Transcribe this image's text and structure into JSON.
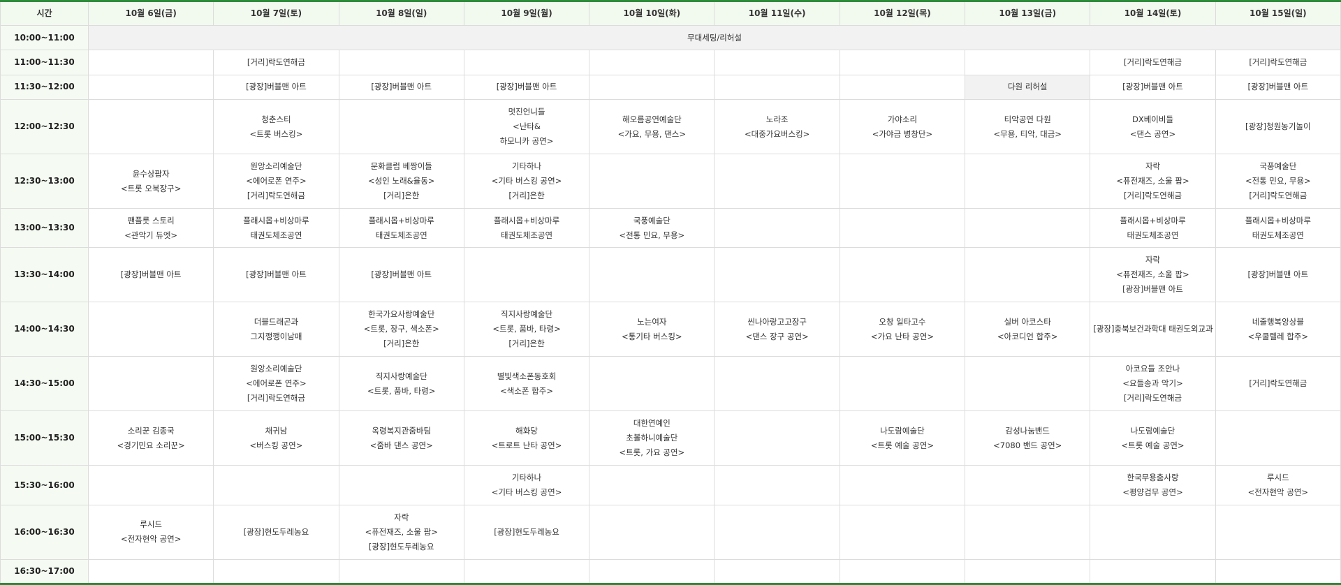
{
  "header": {
    "time_label": "시간",
    "days": [
      "10월 6일(금)",
      "10월 7일(토)",
      "10월 8일(일)",
      "10월 9일(월)",
      "10월 10일(화)",
      "10월 11일(수)",
      "10월 12일(목)",
      "10월 13일(금)",
      "10월 14일(토)",
      "10월 15일(일)"
    ]
  },
  "colors": {
    "accent": "#2e8b3a",
    "header_bg": "#f2f9ef",
    "shaded_cell": "#f2f2f2",
    "grid": "#dcdcdc"
  },
  "rows": [
    {
      "time": "10:00~11:00",
      "full": [
        "무대세팅/리허설"
      ]
    },
    {
      "time": "11:00~11:30",
      "cells": [
        [],
        [
          "[거리]락도연해금"
        ],
        [],
        [],
        [],
        [],
        [],
        [],
        [
          "[거리]락도연해금"
        ],
        [
          "[거리]락도연해금"
        ]
      ]
    },
    {
      "time": "11:30~12:00",
      "cells": [
        [],
        [
          "[광장]버블맨 아트"
        ],
        [
          "[광장]버블맨 아트"
        ],
        [
          "[광장]버블맨 아트"
        ],
        [],
        [],
        [],
        [
          "다원 리허설"
        ],
        [
          "[광장]버블맨 아트"
        ],
        [
          "[광장]버블맨 아트"
        ]
      ],
      "shaded": [
        7
      ]
    },
    {
      "time": "12:00~12:30",
      "cells": [
        [],
        [
          "청춘스티",
          "<트롯 버스킹>"
        ],
        [],
        [
          "멋진언니들",
          "<난타&",
          "하모니카 공연>"
        ],
        [
          "해오름공연예술단",
          "<가요, 무용, 댄스>"
        ],
        [
          "노라조",
          "<대중가요버스킹>"
        ],
        [
          "가야소리",
          "<가야금 병창단>"
        ],
        [
          "티악공연 다원",
          "<무용, 티악, 대금>"
        ],
        [
          "DX베이비들",
          "<댄스 공연>"
        ],
        [
          "[광장]청원농기놀이"
        ]
      ]
    },
    {
      "time": "12:30~13:00",
      "cells": [
        [
          "윤수상팝자",
          "<트롯 오북장구>"
        ],
        [
          "원앙소리예술단",
          "<에어로폰 연주>",
          "[거리]락도연해금"
        ],
        [
          "문화클럽 베짱이들",
          "<성인 노래&율동>",
          "[거리]은한"
        ],
        [
          "기타하나",
          "<기타 버스킹 공연>",
          "[거리]은한"
        ],
        [],
        [],
        [],
        [],
        [
          "자락",
          "<퓨전재즈, 소울 팝>",
          "[거리]락도연해금"
        ],
        [
          "국풍예술단",
          "<전통 민요, 무용>",
          "[거리]락도연해금"
        ]
      ]
    },
    {
      "time": "13:00~13:30",
      "cells": [
        [
          "팬플룻 스토리",
          "<관악기 듀엣>"
        ],
        [
          "플래시몹+비상마루",
          "태권도체조공연"
        ],
        [
          "플래시몹+비상마루",
          "태권도체조공연"
        ],
        [
          "플래시몹+비상마루",
          "태권도체조공연"
        ],
        [
          "국풍예술단",
          "<전통 민요, 무용>"
        ],
        [],
        [],
        [],
        [
          "플래시몹+비상마루",
          "태권도체조공연"
        ],
        [
          "플래시몹+비상마루",
          "태권도체조공연"
        ]
      ]
    },
    {
      "time": "13:30~14:00",
      "cells": [
        [
          "[광장]버블맨 아트"
        ],
        [
          "[광장]버블맨 아트"
        ],
        [
          "[광장]버블맨 아트"
        ],
        [],
        [],
        [],
        [],
        [],
        [
          "자락",
          "<퓨전재즈, 소울 팝>",
          "[광장]버블맨 아트"
        ],
        [
          "[광장]버블맨 아트"
        ]
      ]
    },
    {
      "time": "14:00~14:30",
      "cells": [
        [],
        [
          "더블드래곤과",
          "그지깽깽이남매"
        ],
        [
          "한국가요사랑예술단",
          "<트롯, 장구, 색소폰>",
          "[거리]은한"
        ],
        [
          "직지사랑예술단",
          "<트롯, 품바, 타령>",
          "[거리]은한"
        ],
        [
          "노는여자",
          "<통기타 버스킹>"
        ],
        [
          "씬나아랑고고장구",
          "<댄스 장구 공연>"
        ],
        [
          "오창 일타고수",
          "<가요 난타 공연>"
        ],
        [
          "실버 아코스타",
          "<아코디언 합주>"
        ],
        [
          "[광장]충북보건과학대 태권도외교과 시범단"
        ],
        [
          "네줄행복앙상블",
          "<우쿨렐레 합주>"
        ]
      ]
    },
    {
      "time": "14:30~15:00",
      "cells": [
        [],
        [
          "원앙소리예술단",
          "<에어로폰 연주>",
          "[거리]락도연해금"
        ],
        [
          "직지사랑예술단",
          "<트롯, 품바, 타령>"
        ],
        [
          "별빛색소폰동호회",
          "<색소폰 합주>"
        ],
        [],
        [],
        [],
        [],
        [
          "아코요들 조안나",
          "<요들송과 악기>",
          "[거리]락도연해금"
        ],
        [
          "[거리]락도연해금"
        ]
      ]
    },
    {
      "time": "15:00~15:30",
      "cells": [
        [
          "소리꾼 김종국",
          "<경기민요 소리꾼>"
        ],
        [
          "채귀남",
          "<버스킹 공연>"
        ],
        [
          "옥령복지관줌바팀",
          "<줌바 댄스 공연>"
        ],
        [
          "해화당",
          "<트로트 난타 공연>"
        ],
        [
          "대한연예인",
          "초볼하니예술단",
          "<트롯, 가요 공연>"
        ],
        [],
        [
          "나도람예술단",
          "<트롯 예술 공연>"
        ],
        [
          "감성나눔밴드",
          "<7080 밴드 공연>"
        ],
        [
          "나도람예술단",
          "<트롯 예술 공연>"
        ],
        []
      ]
    },
    {
      "time": "15:30~16:00",
      "cells": [
        [],
        [],
        [],
        [
          "기타하나",
          "<기타 버스킹 공연>"
        ],
        [],
        [],
        [],
        [],
        [
          "한국무용춤사랑",
          "<평양검무 공연>"
        ],
        [
          "루시드",
          "<전자현악 공연>"
        ]
      ]
    },
    {
      "time": "16:00~16:30",
      "cells": [
        [
          "루시드",
          "<전자현악 공연>"
        ],
        [
          "[광장]현도두레농요"
        ],
        [
          "자락",
          "<퓨전재즈, 소울 팝>",
          "[광장]현도두레농요"
        ],
        [
          "[광장]현도두레농요"
        ],
        [],
        [],
        [],
        [],
        [],
        []
      ]
    },
    {
      "time": "16:30~17:00",
      "cells": [
        [],
        [],
        [],
        [],
        [],
        [],
        [],
        [],
        [],
        []
      ]
    }
  ]
}
